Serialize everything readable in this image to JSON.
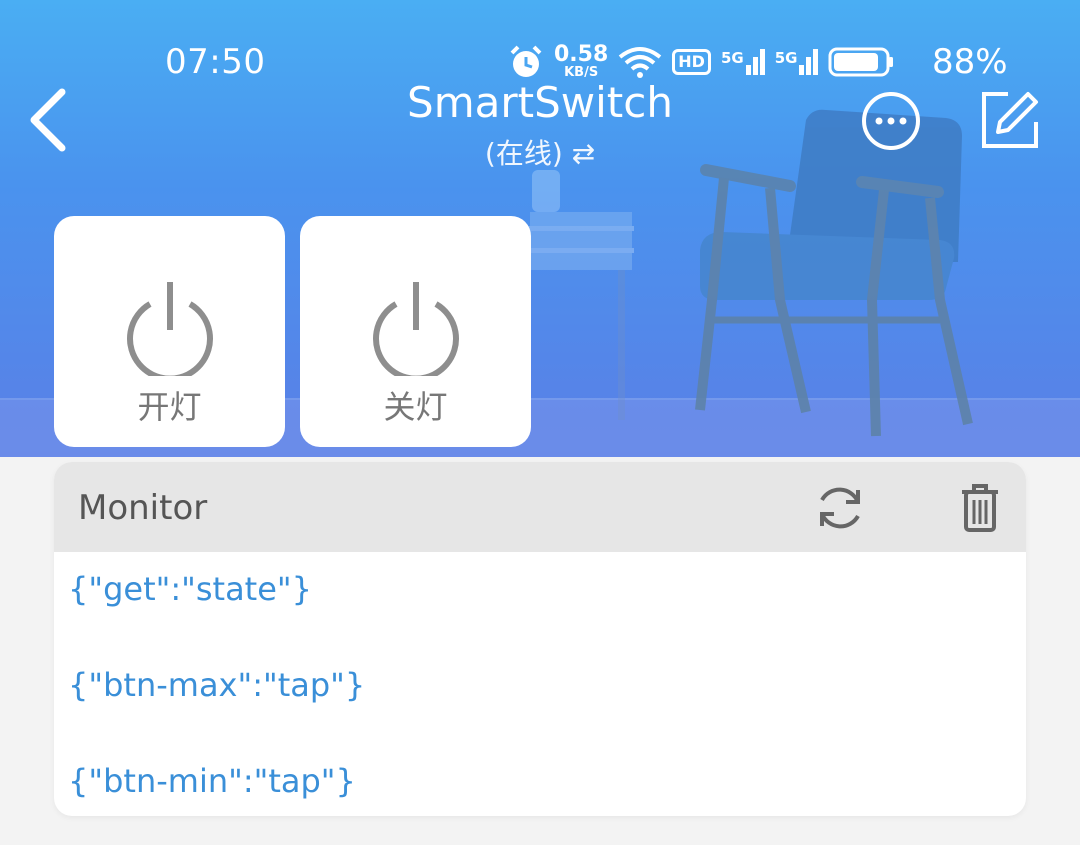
{
  "status_bar": {
    "time": "07:50",
    "net_speed_value": "0.58",
    "net_speed_unit": "KB/S",
    "hd_badge": "HD",
    "sim1_label": "5G",
    "sim2_label": "5G",
    "battery_percent": "88%",
    "battery_level": 0.88
  },
  "header": {
    "title": "SmartSwitch",
    "subtitle": "(在线) ⇄"
  },
  "icons": {
    "back": "chevron-left-icon",
    "more": "more-horizontal-icon",
    "edit": "edit-icon",
    "power": "power-icon",
    "refresh": "refresh-icon",
    "delete": "trash-icon"
  },
  "buttons": [
    {
      "label": "开灯"
    },
    {
      "label": "关灯"
    }
  ],
  "monitor": {
    "title": "Monitor",
    "logs": [
      "{\"get\":\"state\"}",
      "{\"btn-max\":\"tap\"}",
      "{\"btn-min\":\"tap\"}"
    ]
  },
  "colors": {
    "header_gradient_top": "#4aaef3",
    "header_gradient_bottom": "#5a7fe6",
    "log_text": "#3a8fd8",
    "icon_gray": "#8e8e8e"
  }
}
